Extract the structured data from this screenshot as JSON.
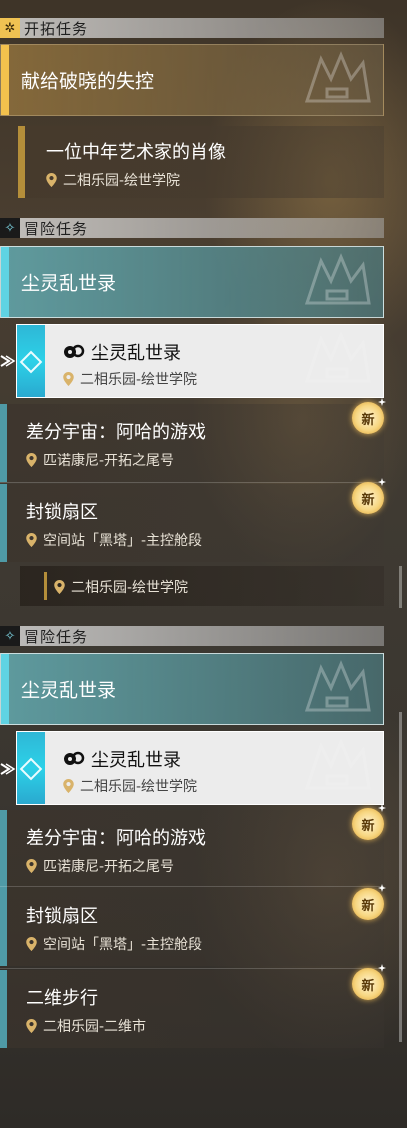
{
  "sections": {
    "frontier": {
      "title": "开拓任务",
      "icon": "trailblaze-icon"
    },
    "adventure1": {
      "title": "冒险任务",
      "icon": "adventure-icon"
    },
    "adventure2": {
      "title": "冒险任务",
      "icon": "adventure-icon"
    }
  },
  "frontier_quest": {
    "title": "献给破晓的失控",
    "sub": {
      "title": "一位中年艺术家的肖像",
      "location": "二相乐园-绘世学院"
    }
  },
  "group1": {
    "header": "尘灵乱世录",
    "selected": {
      "title": "尘灵乱世录",
      "location": "二相乐园-绘世学院"
    },
    "items": [
      {
        "title": "差分宇宙：阿哈的游戏",
        "location": "匹诺康尼-开拓之尾号",
        "badge": "新"
      },
      {
        "title": "封锁扇区",
        "location": "空间站「黑塔」-主控舱段",
        "badge": "新"
      }
    ]
  },
  "mid_row": {
    "location": "二相乐园-绘世学院"
  },
  "group2": {
    "header": "尘灵乱世录",
    "selected": {
      "title": "尘灵乱世录",
      "location": "二相乐园-绘世学院"
    },
    "items": [
      {
        "title": "差分宇宙：阿哈的游戏",
        "location": "匹诺康尼-开拓之尾号",
        "badge": "新"
      },
      {
        "title": "封锁扇区",
        "location": "空间站「黑塔」-主控舱段",
        "badge": "新"
      },
      {
        "title": "二维步行",
        "location": "二相乐园-二维市",
        "badge": "新"
      }
    ]
  },
  "colors": {
    "gold": "#f3c14d",
    "teal": "#5fd3e3",
    "badge": "#f7d680"
  }
}
